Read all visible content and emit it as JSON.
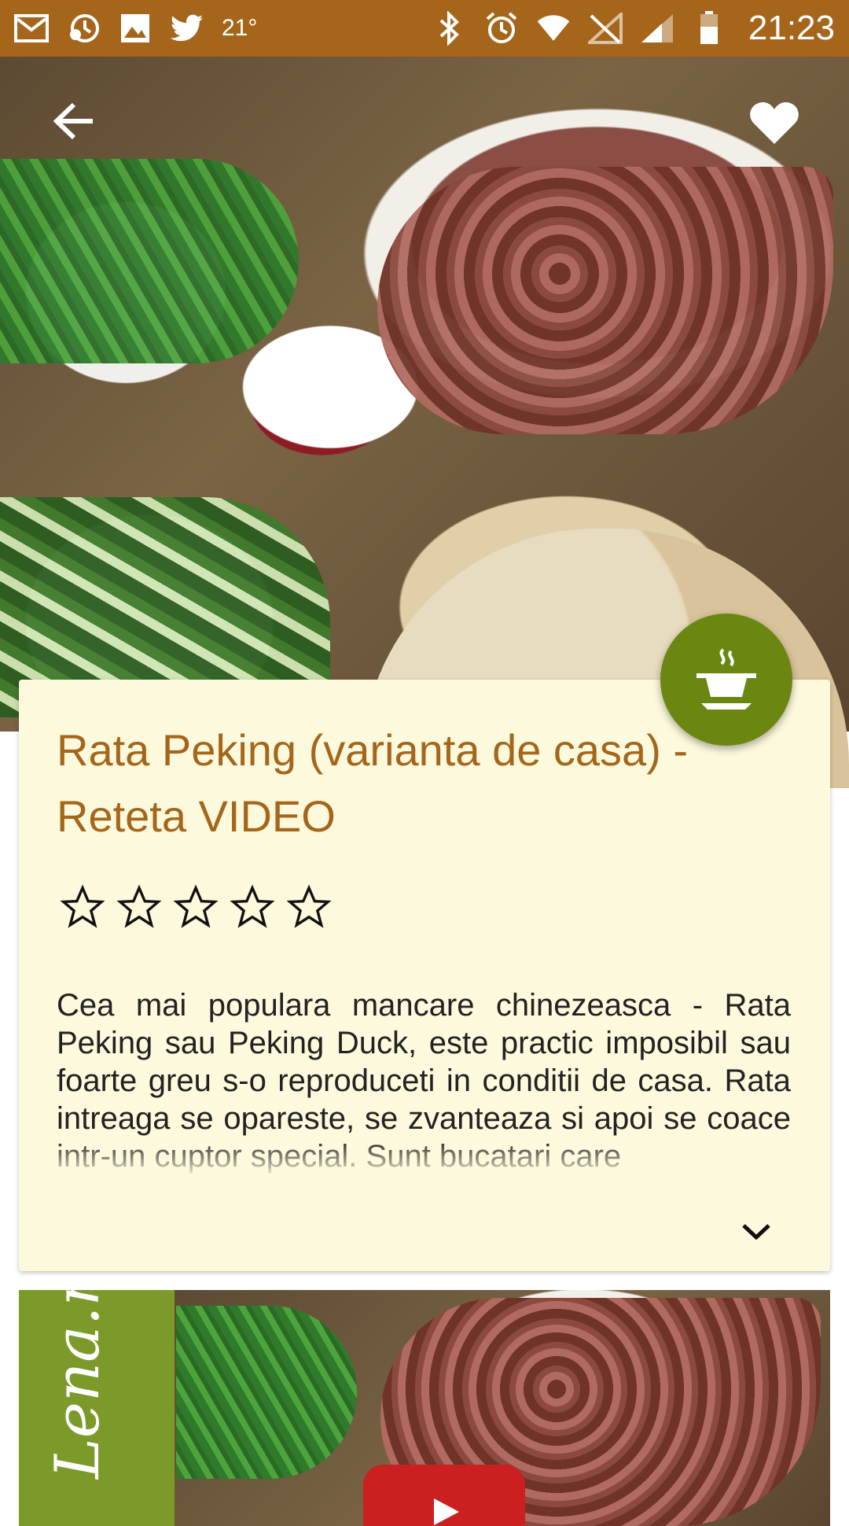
{
  "status_bar": {
    "temperature": "21°",
    "time": "21:23",
    "left_icons": [
      "gmail-icon",
      "backup-history-icon",
      "image-icon",
      "twitter-icon"
    ],
    "right_icons": [
      "bluetooth-icon",
      "alarm-icon",
      "wifi-icon",
      "no-sim-icon",
      "signal-icon",
      "battery-icon"
    ],
    "background": "#a5661b"
  },
  "header": {
    "back_icon": "arrow-back-icon",
    "favorite_icon": "heart-icon"
  },
  "recipe": {
    "title": "Rata Peking (varianta de casa) - Reteta VIDEO",
    "rating": 0,
    "max_rating": 5,
    "description": "Cea mai populara mancare chinezeasca - Rata Peking sau Peking Duck, este practic imposibil sau foarte greu s-o reproduceti in conditii de casa. Rata intreaga se opareste, se zvanteaza si apoi se coace intr-un cuptor special. Sunt bucatari care",
    "expand_icon": "chevron-down-icon"
  },
  "fab": {
    "icon": "cooking-pot-icon",
    "color": "#6b8711"
  },
  "video": {
    "brand_text": "Lena.ro",
    "play_icon": "youtube-play-icon"
  },
  "colors": {
    "accent": "#a5661b",
    "card_background": "#fcf9dc",
    "fab_green": "#6b8711",
    "youtube_red": "#cc1f1f"
  }
}
